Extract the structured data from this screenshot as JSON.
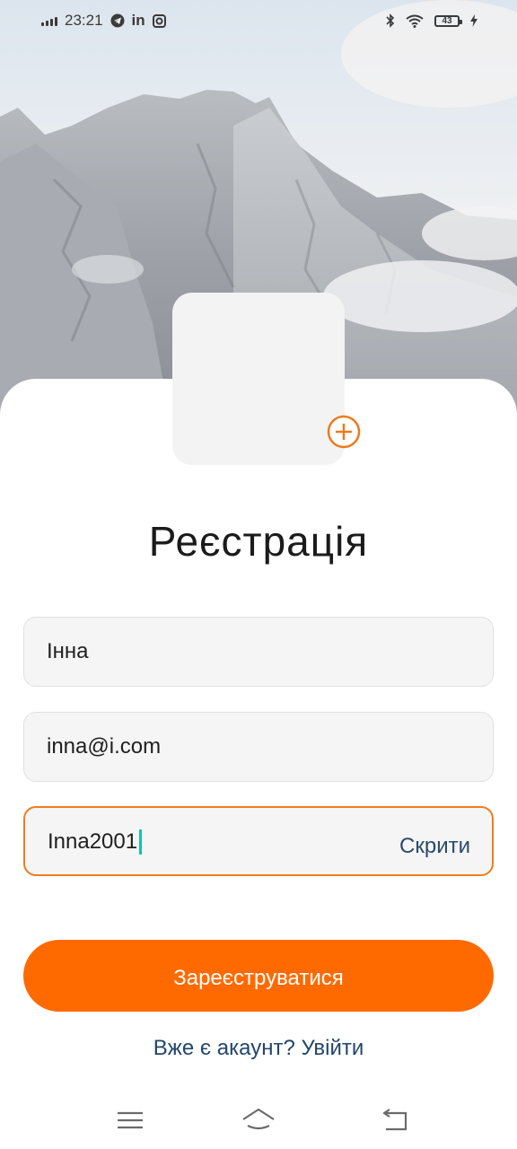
{
  "status_bar": {
    "time": "23:21",
    "battery_level": "43",
    "left_icons": [
      "signal-icon",
      "telegram-icon",
      "linkedin-icon",
      "instagram-icon"
    ],
    "right_icons": [
      "bluetooth-icon",
      "wifi-icon",
      "battery-icon",
      "charging-icon"
    ]
  },
  "form": {
    "title": "Реєстрація",
    "name_value": "Інна",
    "email_value": "inna@i.com",
    "password_value": "Inna2001",
    "password_toggle_label": "Скрити",
    "submit_label": "Зареєструватися",
    "login_link": "Вже є акаунт? Увійти"
  },
  "colors": {
    "accent": "#ff6a00",
    "focus_border": "#f07c1e",
    "link": "#23466b",
    "caret": "#15c2b0"
  },
  "nav": [
    "menu-icon",
    "home-icon",
    "back-icon"
  ]
}
